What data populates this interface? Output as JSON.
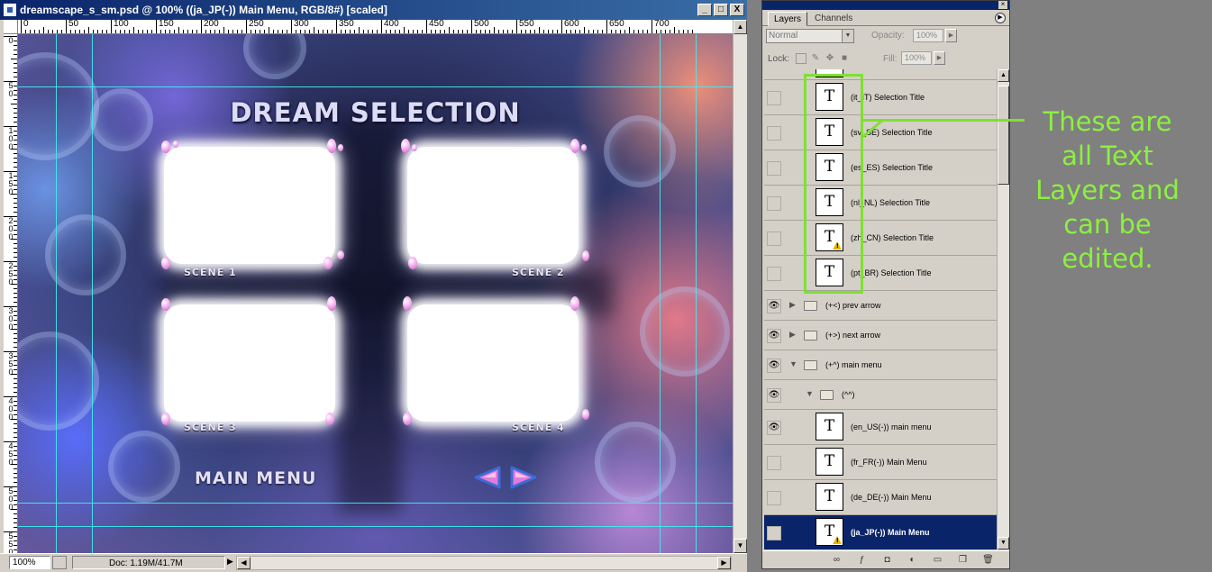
{
  "document": {
    "title": "dreamscape_s_sm.psd @ 100% ((ja_JP(-))  Main Menu, RGB/8#) [scaled]",
    "window_buttons": [
      "_",
      "□",
      "X"
    ],
    "ruler_top_labels": [
      "0",
      "50",
      "100",
      "150",
      "200",
      "250",
      "300",
      "350",
      "400",
      "450",
      "500",
      "550",
      "600",
      "650",
      "700"
    ],
    "ruler_left_labels": [
      "0",
      "5\n0",
      "1\n0\n0",
      "1\n5\n0",
      "2\n0\n0",
      "2\n5\n0",
      "3\n0\n0",
      "3\n5\n0",
      "4\n0\n0",
      "4\n5\n0",
      "5\n0\n0",
      "5\n5\n0"
    ],
    "canvas": {
      "heading": "DREAM SELECTION",
      "scenes": [
        "SCENE 1",
        "SCENE 2",
        "SCENE 3",
        "SCENE 4"
      ],
      "main_menu": "MAIN MENU",
      "prev_arrow": "prev-arrow",
      "next_arrow": "next-arrow"
    },
    "status": {
      "zoom": "100%",
      "doc_info": "Doc: 1.19M/41.7M"
    }
  },
  "layers_panel": {
    "tabs": [
      "Layers",
      "Channels"
    ],
    "blend_mode": "Normal",
    "opacity_label": "Opacity:",
    "opacity_value": "100%",
    "lock_label": "Lock:",
    "fill_label": "Fill:",
    "fill_value": "100%",
    "layers": [
      {
        "name": "(it_IT) Selection Title",
        "kind": "text",
        "visible": false,
        "warning": false
      },
      {
        "name": "(sv_SE) Selection Title",
        "kind": "text",
        "visible": false,
        "warning": false
      },
      {
        "name": "(es_ES) Selection Title",
        "kind": "text",
        "visible": false,
        "warning": false
      },
      {
        "name": "(nl_NL) Selection Title",
        "kind": "text",
        "visible": false,
        "warning": false
      },
      {
        "name": "(zh_CN) Selection Title",
        "kind": "text",
        "visible": false,
        "warning": true
      },
      {
        "name": "(pt_BR) Selection Title",
        "kind": "text",
        "visible": false,
        "warning": false
      },
      {
        "name": "(+<) prev arrow",
        "kind": "group",
        "visible": true,
        "expanded": false
      },
      {
        "name": "(+>) next arrow",
        "kind": "group",
        "visible": true,
        "expanded": false
      },
      {
        "name": "(+^) main menu",
        "kind": "group",
        "visible": true,
        "expanded": true
      },
      {
        "name": "(^^)",
        "kind": "group",
        "visible": true,
        "expanded": true
      },
      {
        "name": "(en_US(-))  main menu",
        "kind": "text",
        "visible": true,
        "warning": false
      },
      {
        "name": "(fr_FR(-))  Main Menu",
        "kind": "text",
        "visible": false,
        "warning": false
      },
      {
        "name": "(de_DE(-))  Main Menu",
        "kind": "text",
        "visible": false,
        "warning": false
      },
      {
        "name": "(ja_JP(-))  Main Menu",
        "kind": "text",
        "visible": false,
        "warning": true,
        "selected": true
      }
    ]
  },
  "annotation": {
    "text": "These are all Text Layers and can be edited.",
    "color": "#8cf040"
  }
}
